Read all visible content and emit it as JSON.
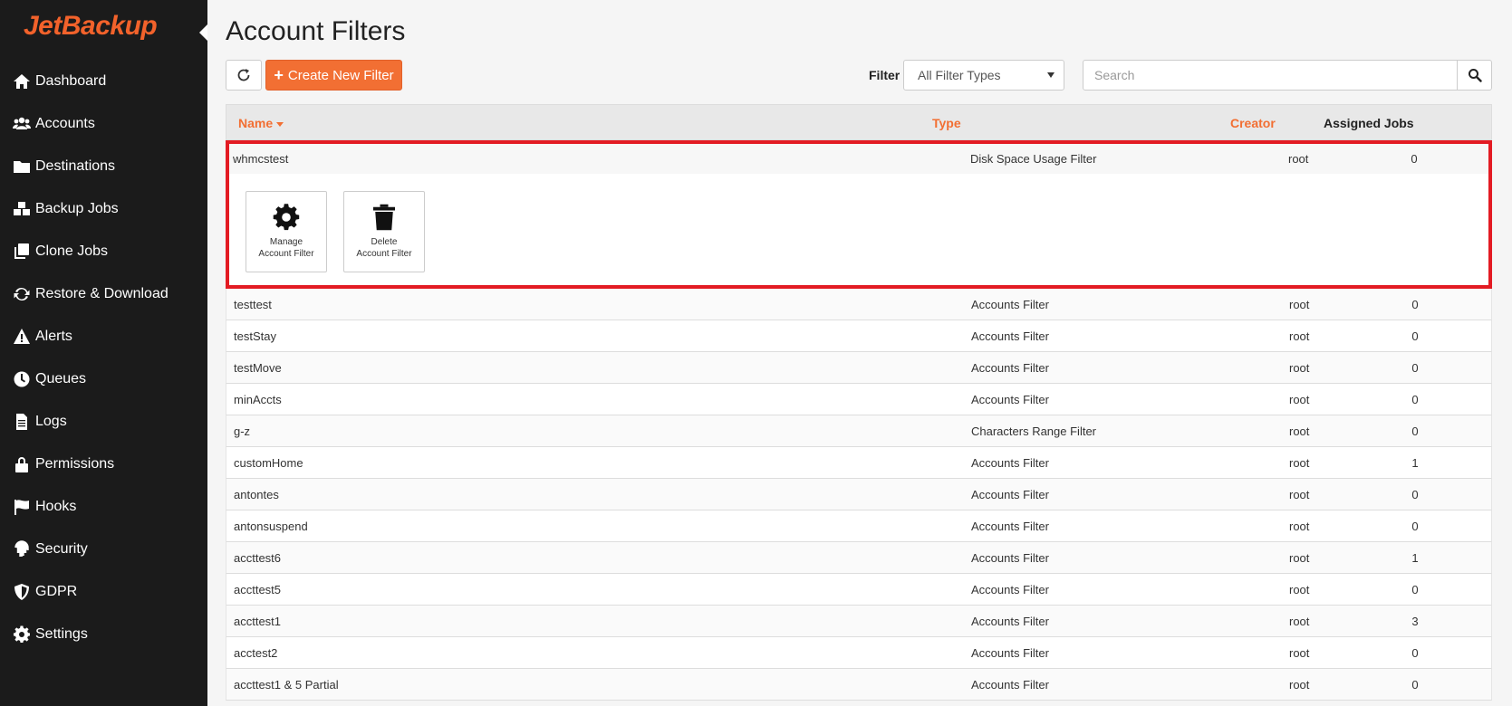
{
  "brand": {
    "logo_text": "JetBackup",
    "accent": "#f26f33",
    "sidebar_bg": "#1b1b1b",
    "highlight": "#e31b23"
  },
  "sidebar": {
    "items": [
      {
        "label": "Dashboard",
        "icon": "home-icon"
      },
      {
        "label": "Accounts",
        "icon": "users-icon"
      },
      {
        "label": "Destinations",
        "icon": "folder-icon"
      },
      {
        "label": "Backup Jobs",
        "icon": "cubes-icon"
      },
      {
        "label": "Clone Jobs",
        "icon": "clone-icon"
      },
      {
        "label": "Restore & Download",
        "icon": "refresh-icon"
      },
      {
        "label": "Alerts",
        "icon": "warning-icon"
      },
      {
        "label": "Queues",
        "icon": "clock-icon"
      },
      {
        "label": "Logs",
        "icon": "file-icon"
      },
      {
        "label": "Permissions",
        "icon": "lock-icon"
      },
      {
        "label": "Hooks",
        "icon": "flag-icon"
      },
      {
        "label": "Security",
        "icon": "fingerprint-icon"
      },
      {
        "label": "GDPR",
        "icon": "shield-icon"
      },
      {
        "label": "Settings",
        "icon": "gear-icon"
      }
    ]
  },
  "page": {
    "title": "Account Filters"
  },
  "toolbar": {
    "create_label": "Create New Filter",
    "filter_label": "Filter",
    "filter_value": "All Filter Types",
    "search_placeholder": "Search"
  },
  "table": {
    "headers": {
      "name": "Name",
      "type": "Type",
      "creator": "Creator",
      "jobs": "Assigned Jobs"
    },
    "selected": {
      "name": "whmcstest",
      "type": "Disk Space Usage Filter",
      "creator": "root",
      "jobs": "0",
      "actions": [
        {
          "label_line1": "Manage",
          "label_line2": "Account Filter",
          "icon": "gear-icon"
        },
        {
          "label_line1": "Delete",
          "label_line2": "Account Filter",
          "icon": "trash-icon"
        }
      ]
    },
    "rows": [
      {
        "name": "testtest",
        "type": "Accounts Filter",
        "creator": "root",
        "jobs": "0"
      },
      {
        "name": "testStay",
        "type": "Accounts Filter",
        "creator": "root",
        "jobs": "0"
      },
      {
        "name": "testMove",
        "type": "Accounts Filter",
        "creator": "root",
        "jobs": "0"
      },
      {
        "name": "minAccts",
        "type": "Accounts Filter",
        "creator": "root",
        "jobs": "0"
      },
      {
        "name": "g-z",
        "type": "Characters Range Filter",
        "creator": "root",
        "jobs": "0"
      },
      {
        "name": "customHome",
        "type": "Accounts Filter",
        "creator": "root",
        "jobs": "1"
      },
      {
        "name": "antontes",
        "type": "Accounts Filter",
        "creator": "root",
        "jobs": "0"
      },
      {
        "name": "antonsuspend",
        "type": "Accounts Filter",
        "creator": "root",
        "jobs": "0"
      },
      {
        "name": "accttest6",
        "type": "Accounts Filter",
        "creator": "root",
        "jobs": "1"
      },
      {
        "name": "accttest5",
        "type": "Accounts Filter",
        "creator": "root",
        "jobs": "0"
      },
      {
        "name": "accttest1",
        "type": "Accounts Filter",
        "creator": "root",
        "jobs": "3"
      },
      {
        "name": "acctest2",
        "type": "Accounts Filter",
        "creator": "root",
        "jobs": "0"
      },
      {
        "name": "accttest1 & 5 Partial",
        "type": "Accounts Filter",
        "creator": "root",
        "jobs": "0"
      }
    ]
  }
}
